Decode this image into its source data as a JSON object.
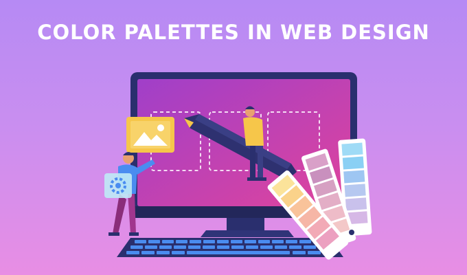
{
  "banner": {
    "title": "COLOR PALETTES IN WEB DESIGN"
  },
  "illustration": {
    "scene": "designer-at-monitor-with-color-swatches",
    "icons": [
      "monitor-icon",
      "image-placeholder-icon",
      "pencil-icon",
      "gear-icon",
      "keyboard-icon",
      "swatch-fan-icon"
    ]
  },
  "colors": {
    "background_top": "#b68af4",
    "background_bottom": "#e88ee4",
    "monitor_frame": "#2a2f6e",
    "screen_top": "#a03fc9",
    "screen_bottom": "#e0449c",
    "accent_yellow": "#f6c64a",
    "accent_blue": "#4a8cf0"
  }
}
